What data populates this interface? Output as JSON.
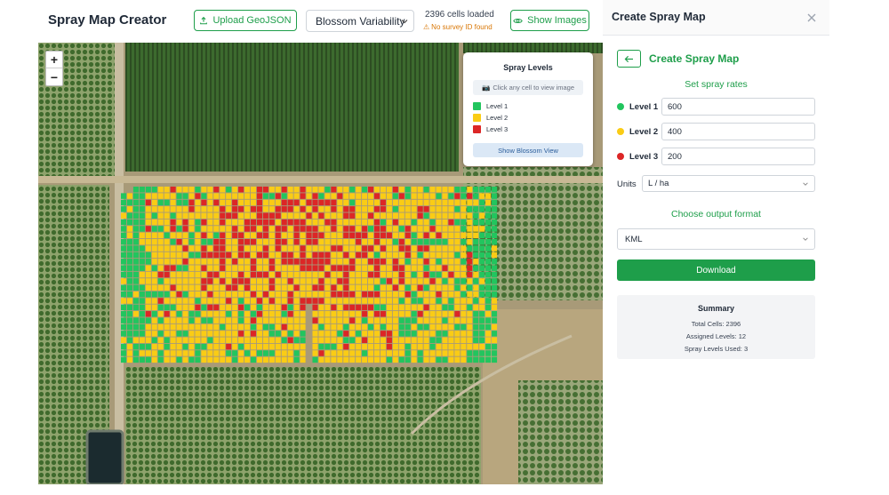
{
  "app": {
    "title": "Spray Map Creator"
  },
  "toolbar": {
    "upload_label": "Upload GeoJSON",
    "layer_selected": "Blossom Variability",
    "cells_loaded": "2396 cells loaded",
    "survey_warning": "No survey ID found",
    "show_images_label": "Show Images"
  },
  "map": {
    "zoom_in": "+",
    "zoom_out": "−",
    "legend": {
      "title": "Spray Levels",
      "hint": "Click any cell to view image",
      "items": [
        {
          "label": "Level 1",
          "color": "#22c55e"
        },
        {
          "label": "Level 2",
          "color": "#facc15"
        },
        {
          "label": "Level 3",
          "color": "#dc2626"
        }
      ],
      "toggle_label": "Show Blossom View"
    }
  },
  "panel": {
    "title": "Create Spray Map",
    "subtitle": "Create Spray Map",
    "rates_title": "Set spray rates",
    "levels": [
      {
        "label": "Level 1",
        "value": "600",
        "color": "#22c55e"
      },
      {
        "label": "Level 2",
        "value": "400",
        "color": "#facc15"
      },
      {
        "label": "Level 3",
        "value": "200",
        "color": "#dc2626"
      }
    ],
    "units_label": "Units",
    "units_value": "L / ha",
    "format_title": "Choose output format",
    "format_value": "KML",
    "download_label": "Download",
    "summary": {
      "title": "Summary",
      "total_cells": "Total Cells: 2396",
      "assigned_levels": "Assigned Levels: 12",
      "levels_used": "Spray Levels Used: 3"
    }
  },
  "colors": {
    "accent": "#1e9e4a",
    "warning": "#d97706"
  }
}
